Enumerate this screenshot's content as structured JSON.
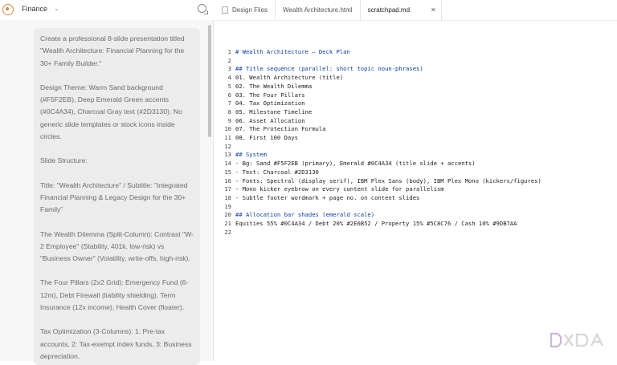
{
  "sidebar": {
    "project_name": "Finance",
    "prompt_paragraphs": [
      "Create a professional 8-slide presentation titled \"Wealth Architecture: Financial Planning for the 30+ Family Builder.\"",
      "Design Theme: Warm Sand background (#F5F2EB), Deep Emerald Green accents (#0C4A34), Charcoal Gray text (#2D3130). No generic slide templates or stock icons inside circles.",
      "Slide Structure:",
      "Title: \"Wealth Architecture\" / Subtitle: \"Integrated Financial Planning & Legacy Design for the 30+ Family\"",
      "The Wealth Dilemma (Split-Column): Contrast \"W-2 Employee\" (Stability, 401k, low-risk) vs \"Business Owner\" (Volatility, write-offs, high-risk).",
      "The Four Pillars (2x2 Grid): Emergency Fund (6-12m), Debt Firewall (liability shielding), Term Insurance (12x income), Health Cover (floater).",
      "Tax Optimization (3-Columns): 1: Pre-tax accounts, 2: Tax-exempt index funds, 3: Business depreciation."
    ]
  },
  "tabs": [
    {
      "label": "Design Files",
      "active": false
    },
    {
      "label": "Wealth Architecture.html",
      "active": false
    },
    {
      "label": "scratchpad.md",
      "active": true
    }
  ],
  "editor": {
    "lines": [
      {
        "n": "1",
        "text": "# Wealth Architecture — Deck Plan",
        "kind": "h1"
      },
      {
        "n": "2",
        "text": "",
        "kind": "text"
      },
      {
        "n": "3",
        "text": "## Title sequence (parallel: short topic noun-phrases)",
        "kind": "h2"
      },
      {
        "n": "4",
        "text": "01. Wealth Architecture (title)",
        "kind": "list"
      },
      {
        "n": "5",
        "text": "02. The Wealth Dilemma",
        "kind": "list"
      },
      {
        "n": "6",
        "text": "03. The Four Pillars",
        "kind": "list"
      },
      {
        "n": "7",
        "text": "04. Tax Optimization",
        "kind": "list"
      },
      {
        "n": "8",
        "text": "05. Milestone Timeline",
        "kind": "list"
      },
      {
        "n": "9",
        "text": "06. Asset Allocation",
        "kind": "list"
      },
      {
        "n": "10",
        "text": "07. The Protection Formula",
        "kind": "list"
      },
      {
        "n": "11",
        "text": "08. First 100 Days",
        "kind": "list"
      },
      {
        "n": "12",
        "text": "",
        "kind": "text"
      },
      {
        "n": "13",
        "text": "## System",
        "kind": "h2"
      },
      {
        "n": "14",
        "text": "- Bg: Sand #F5F2EB (primary), Emerald #0C4A34 (title slide + accents)",
        "kind": "text"
      },
      {
        "n": "15",
        "text": "- Text: Charcoal #2D3130",
        "kind": "text"
      },
      {
        "n": "16",
        "text": "- Fonts: Spectral (display serif), IBM Plex Sans (body), IBM Plex Mono (kickers/figures)",
        "kind": "text"
      },
      {
        "n": "17",
        "text": "- Mono kicker eyebrow on every content slide for parallelism",
        "kind": "text"
      },
      {
        "n": "18",
        "text": "- Subtle footer wordmark + page no. on content slides",
        "kind": "text"
      },
      {
        "n": "19",
        "text": "",
        "kind": "text"
      },
      {
        "n": "20",
        "text": "## Allocation bar shades (emerald scale)",
        "kind": "h2"
      },
      {
        "n": "21",
        "text": "Equities 55% #0C4A34 / Debt 20% #2E6B52 / Property 15% #5C8C76 / Cash 10% #9DB7AA",
        "kind": "text"
      },
      {
        "n": "22",
        "text": "",
        "kind": "text"
      }
    ]
  },
  "watermark": {
    "text": "XDA"
  },
  "colors": {
    "heading": "#0b3ea8",
    "accent": "#d08a3c"
  }
}
